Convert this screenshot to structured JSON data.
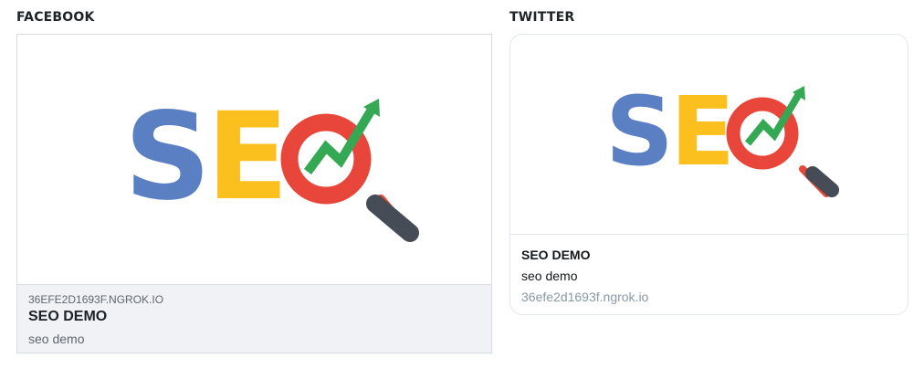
{
  "facebook": {
    "section_title": "FACEBOOK",
    "logo": {
      "letters": [
        "S",
        "E"
      ]
    },
    "domain": "36EFE2D1693F.NGROK.IO",
    "headline": "SEO DEMO",
    "description": "seo demo"
  },
  "twitter": {
    "section_title": "TWITTER",
    "logo": {
      "letters": [
        "S",
        "E"
      ]
    },
    "headline": "SEO DEMO",
    "description": "seo demo",
    "domain": "36efe2d1693f.ngrok.io"
  },
  "colors": {
    "logo_blue": "#5b7fc3",
    "logo_yellow": "#fbbf1e",
    "logo_red": "#e8463a",
    "logo_green": "#34a853",
    "magnifier_handle": "#464c55"
  }
}
